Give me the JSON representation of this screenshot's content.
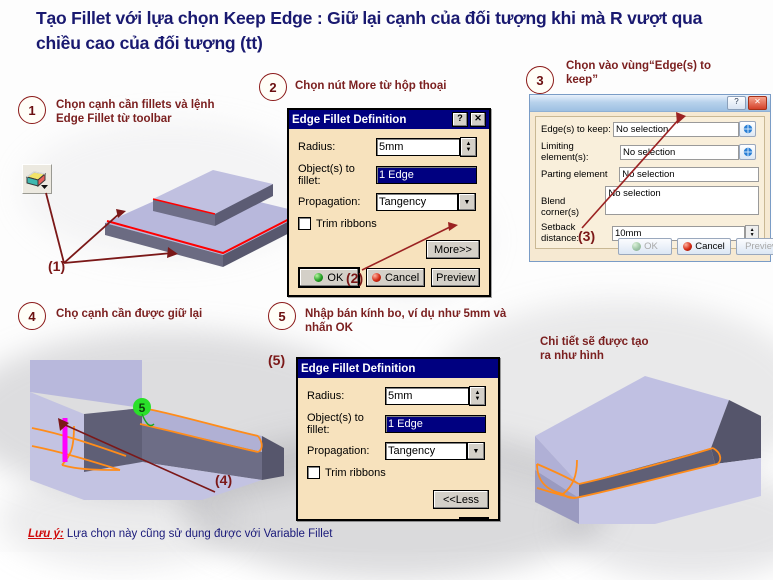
{
  "title": "Tạo Fillet với lựa chọn Keep Edge : Giữ lại cạnh của đối tượng khi mà R vượt qua chiều cao của đối tượng (tt)",
  "steps": [
    {
      "num": "1",
      "text": "Chọn cạnh cần fillets và lệnh\nEdge Fillet từ toolbar"
    },
    {
      "num": "2",
      "text": "Chọn nút More từ hộp thoại"
    },
    {
      "num": "3",
      "text": "Chọn vào vùng“Edge(s) to\nkeep”"
    },
    {
      "num": "4",
      "text": "Chọ cạnh cần được giữ lại"
    },
    {
      "num": "5",
      "text": "Nhập bán kính bo, ví dụ như 5mm và\nnhấn OK"
    }
  ],
  "refs": {
    "r1": "(1)",
    "r2": "(2)",
    "r3": "(3)",
    "r4": "(4)",
    "r5": "(5)"
  },
  "result_caption": "Chi tiết sẽ được tạo\nra như hình",
  "dialog1": {
    "title": "Edge Fillet Definition",
    "help_btn": "?",
    "close_btn": "✕",
    "radius_label": "Radius:",
    "radius_value": "5mm",
    "objects_label": "Object(s) to fillet:",
    "objects_value": "1 Edge",
    "propagation_label": "Propagation:",
    "propagation_value": "Tangency",
    "trim_label": "Trim ribbons",
    "more_label": "More>>",
    "ok_label": "OK",
    "cancel_label": "Cancel",
    "preview_label": "Preview"
  },
  "dialog2": {
    "title": "Edge Fillet Definition",
    "radius_label": "Radius:",
    "radius_value": "5mm",
    "objects_label": "Object(s) to fillet:",
    "objects_value": "1 Edge",
    "propagation_label": "Propagation:",
    "propagation_value": "Tangency",
    "trim_label": "Trim ribbons",
    "less_label": "<<Less"
  },
  "panel3": {
    "help_btn": "?",
    "close_btn": "✕",
    "fields": [
      {
        "label": "Edge(s) to keep:",
        "value": "No selection",
        "picker": true
      },
      {
        "label": "Limiting element(s):",
        "value": "No selection",
        "picker": true
      },
      {
        "label": "Parting element",
        "value": "No selection",
        "picker": false
      },
      {
        "label": "Blend corner(s)",
        "value": "No selection",
        "picker": false
      },
      {
        "label": "Setback distance:",
        "value": "10mm",
        "picker": false
      }
    ],
    "ok_label": "OK",
    "cancel_label": "Cancel",
    "preview_label": "Preview"
  },
  "viewport_label_5": "5",
  "footer": {
    "prefix": "Lưu ý:",
    "text": " Lựa chọn này cũng sử dụng được với Variable Fillet"
  },
  "colors": {
    "title": "#191970",
    "callout": "#7B2020",
    "dialog_title_bar": "#000080",
    "dialog_body": "#f7e2bd",
    "highlight_edge": "#ff0000",
    "fillet_preview": "#ff8c1a",
    "kept_edge": "#ff00ff",
    "solid_face": "#b3b3d9",
    "solid_shade": "#63637a",
    "footer_note": "#cf0a0a"
  }
}
